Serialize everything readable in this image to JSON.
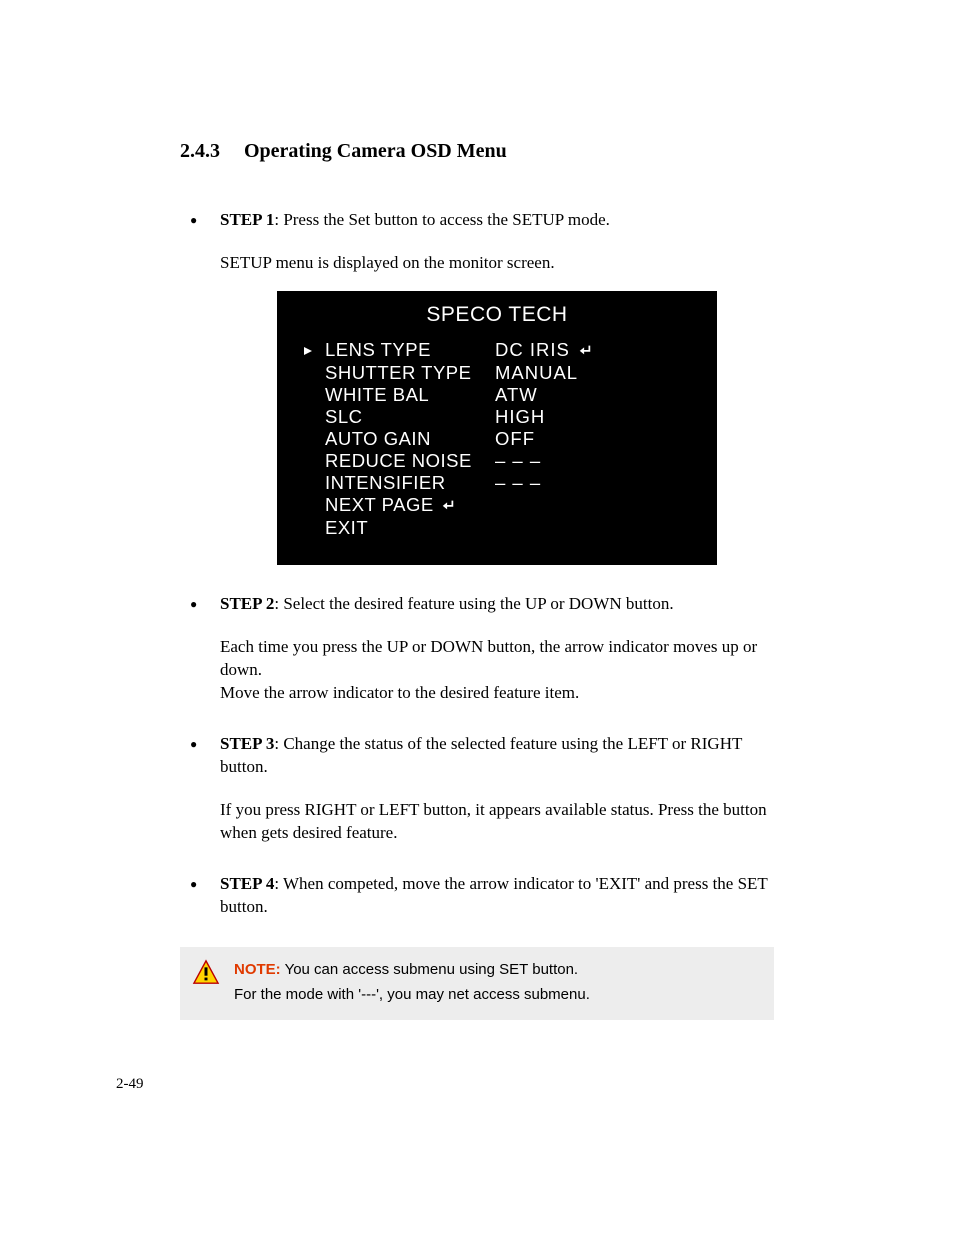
{
  "heading": {
    "number": "2.4.3",
    "title": "Operating Camera OSD Menu"
  },
  "steps": [
    {
      "label": "STEP 1",
      "text": ": Press the Set button to access the SETUP mode.",
      "follow": "SETUP menu is displayed on the monitor screen."
    },
    {
      "label": "STEP 2",
      "text": ": Select the desired feature using the UP or DOWN button.",
      "follow": "Each time you press the UP or DOWN button, the arrow indicator moves up or down.\nMove the arrow indicator to the desired feature item."
    },
    {
      "label": "STEP 3",
      "text": ": Change the status of the selected feature using the LEFT or RIGHT button.",
      "follow": "If you press RIGHT or LEFT button, it appears available status. Press the button when gets desired feature."
    },
    {
      "label": "STEP 4",
      "text": ": When competed, move the arrow indicator to 'EXIT' and press the SET button.",
      "follow": ""
    }
  ],
  "osd": {
    "title": "SPECO TECH",
    "rows": [
      {
        "cursor": true,
        "label": "LENS TYPE",
        "value": "DC  IRIS",
        "enter": true
      },
      {
        "cursor": false,
        "label": "SHUTTER TYPE",
        "value": "MANUAL",
        "enter": false
      },
      {
        "cursor": false,
        "label": "WHITE  BAL",
        "value": "ATW",
        "enter": false
      },
      {
        "cursor": false,
        "label": "SLC",
        "value": "HIGH",
        "enter": false
      },
      {
        "cursor": false,
        "label": "AUTO  GAIN",
        "value": "OFF",
        "enter": false
      },
      {
        "cursor": false,
        "label": "REDUCE NOISE",
        "value": "– – –",
        "enter": false
      },
      {
        "cursor": false,
        "label": "INTENSIFIER",
        "value": "– – –",
        "enter": false
      },
      {
        "cursor": false,
        "label": "NEXT  PAGE",
        "value": "",
        "enter_after_label": true
      },
      {
        "cursor": false,
        "label": "EXIT",
        "value": "",
        "enter": false
      }
    ]
  },
  "note": {
    "label": "NOTE:",
    "line1": " You can access submenu using SET button.",
    "line2": "For the mode with '---', you may net access submenu."
  },
  "page_number": "2-49"
}
